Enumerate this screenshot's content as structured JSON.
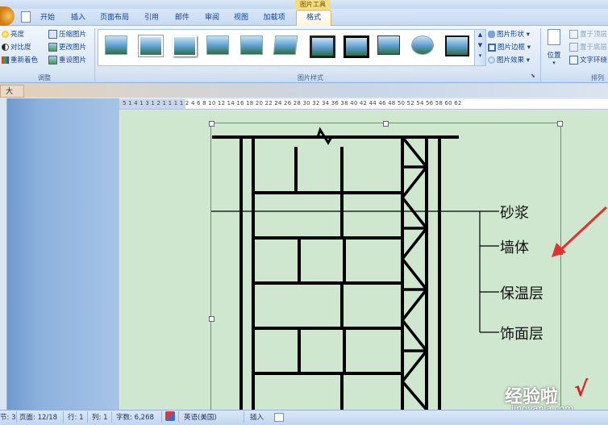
{
  "title_bar": {
    "context_tab_title": "图片工具"
  },
  "tabs": [
    "开始",
    "插入",
    "页面布局",
    "引用",
    "邮件",
    "审阅",
    "视图",
    "加载项"
  ],
  "active_tab": "格式",
  "ribbon": {
    "adjust": {
      "label": "调整",
      "items": [
        "亮度",
        "对比度",
        "重新着色",
        "压缩图片",
        "更改图片",
        "重设图片"
      ]
    },
    "picture_styles": {
      "label": "图片样式",
      "commands": [
        "图片形状",
        "图片边框",
        "图片效果"
      ]
    },
    "arrange": {
      "label": "排列",
      "position_label": "位置",
      "items": [
        "置于顶层",
        "置于底层",
        "文字环绕"
      ]
    }
  },
  "document_tab_char": "大",
  "ruler_text": "5 1 4 1 3 1 2 1 1 1   1  2  4  6  8  10 12 14 16 18 20 22 24 26 28 30 32 34 36 38 40 42 44 46 48 50 52 54 56 58 60 62",
  "diagram": {
    "labels": [
      "砂浆",
      "墙体",
      "保温层",
      "饰面层"
    ]
  },
  "watermark": {
    "main": "经验啦",
    "url": "jingyanla.com",
    "check": "√"
  },
  "status_bar": {
    "section": "节: 3",
    "page": "页面: 12/18",
    "row": "行: 1",
    "col": "列: 1",
    "words": "字数: 6,268",
    "language": "英语(美国)",
    "mode": "插入"
  },
  "colors": {
    "page_green": "#cfe7cf",
    "arrow_red": "#e53030",
    "ribbon_blue": "#dfe9f5"
  }
}
